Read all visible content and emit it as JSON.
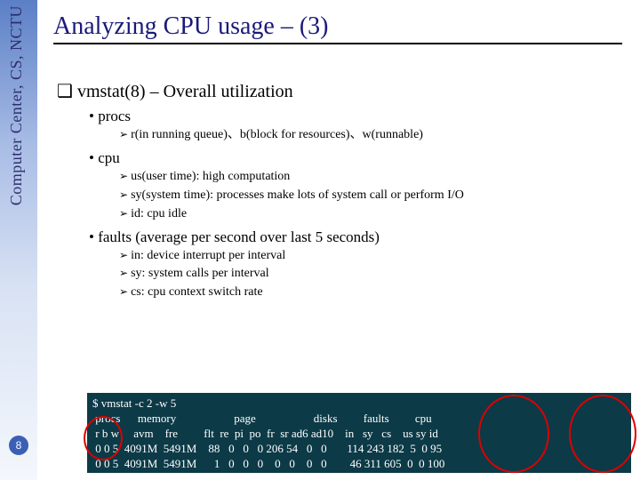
{
  "sidebar": {
    "org": "Computer Center, CS, NCTU",
    "page": "8"
  },
  "title": "Analyzing CPU usage – (3)",
  "section": {
    "heading": "vmstat(8) – Overall utilization",
    "items": [
      {
        "label": "procs",
        "subs": [
          "r(in running queue)、b(block for resources)、w(runnable)"
        ]
      },
      {
        "label": "cpu",
        "subs": [
          "us(user time): high computation",
          "sy(system time): processes  make lots of system call or perform I/O",
          "id: cpu idle"
        ]
      },
      {
        "label": "faults (average per second over last 5 seconds)",
        "subs": [
          "in: device interrupt per interval",
          "sy: system calls per interval",
          "cs: cpu context switch rate"
        ]
      }
    ]
  },
  "terminal": {
    "lines": [
      "$ vmstat -c 2 -w 5",
      " procs      memory                    page                    disks         faults         cpu",
      " r b w     avm    fre         flt  re  pi  po  fr  sr ad6 ad10    in   sy   cs    us sy id",
      " 0 0 5  4091M  5491M    88   0   0   0 206 54   0   0       114 243 182  5  0 95",
      " 0 0 5  4091M  5491M      1   0   0   0    0   0    0   0        46 311 605  0  0 100"
    ]
  }
}
